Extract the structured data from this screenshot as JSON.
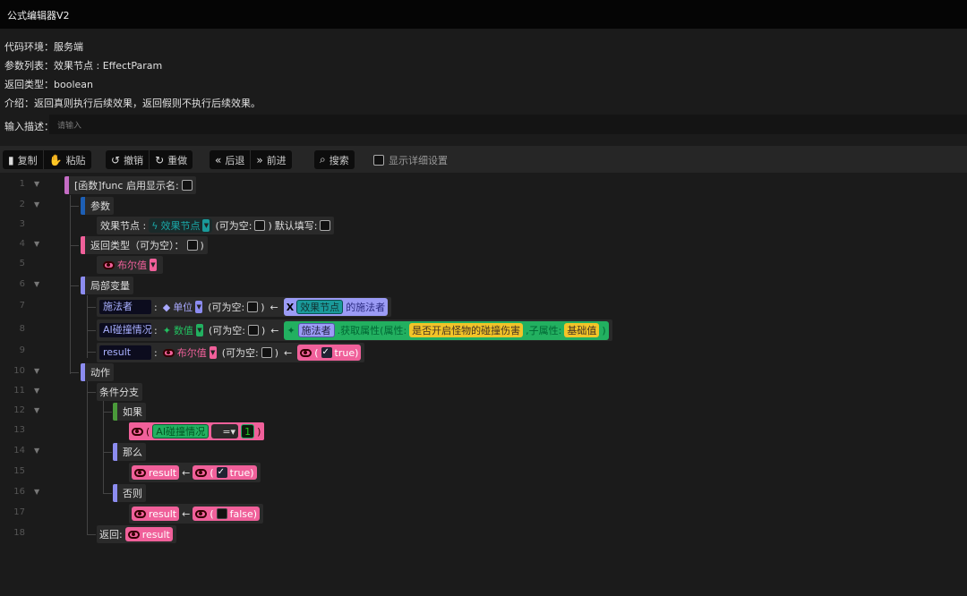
{
  "title": "公式编辑器V2",
  "info": {
    "env": "代码环境：服务端",
    "params": "参数列表：效果节点 : EffectParam",
    "ret": "返回类型：boolean",
    "intro": "介绍：返回真则执行后续效果，返回假则不执行后续效果。"
  },
  "desc": {
    "label": "输入描述：",
    "placeholder": "请输入"
  },
  "toolbar": {
    "copy": "复制",
    "paste": "粘贴",
    "undo": "撤销",
    "redo": "重做",
    "back": "后退",
    "forward": "前进",
    "search": "搜索",
    "detail": "显示详细设置"
  },
  "line_numbers": [
    "1",
    "2",
    "3",
    "4",
    "5",
    "6",
    "7",
    "8",
    "9",
    "10",
    "11",
    "12",
    "13",
    "14",
    "15",
    "16",
    "17",
    "18"
  ],
  "code": {
    "func": "[函数]func 启用显示名:",
    "params": "参数",
    "param_name": "效果节点 :",
    "param_type": "效果节点",
    "nullable": "(可为空:",
    "close": ")",
    "default": "默认填写:",
    "ret_type": "返回类型（可为空）：",
    "bool": "布尔值",
    "locals": "局部变量",
    "colon": ":",
    "arrow": "←",
    "var1": "施法者",
    "unit": "单位",
    "effect_node": "效果节点",
    "caster_of": "的施法者",
    "var2": "AI碰撞情况",
    "number": "数值",
    "get_attr": ".获取属性(属性:",
    "attr": "是否开启怪物的碰撞伤害",
    "sub_attr": ",子属性:",
    "base": "基础值",
    "paren_close": ")",
    "var3": "result",
    "paren_open": "(",
    "true": "true)",
    "false": "false)",
    "actions": "动作",
    "branch": "条件分支",
    "if": "如果",
    "eq": "=▾",
    "one": "1",
    "then": "那么",
    "else": "否则",
    "return": "返回:"
  },
  "colors": {
    "func": "#c46cc4",
    "params": "#1d5fb5",
    "pink": "#f0609a",
    "purple": "#8c8cf0",
    "green": "#22b060",
    "teal": "#1a9a9a",
    "yellow": "#f2c428"
  }
}
